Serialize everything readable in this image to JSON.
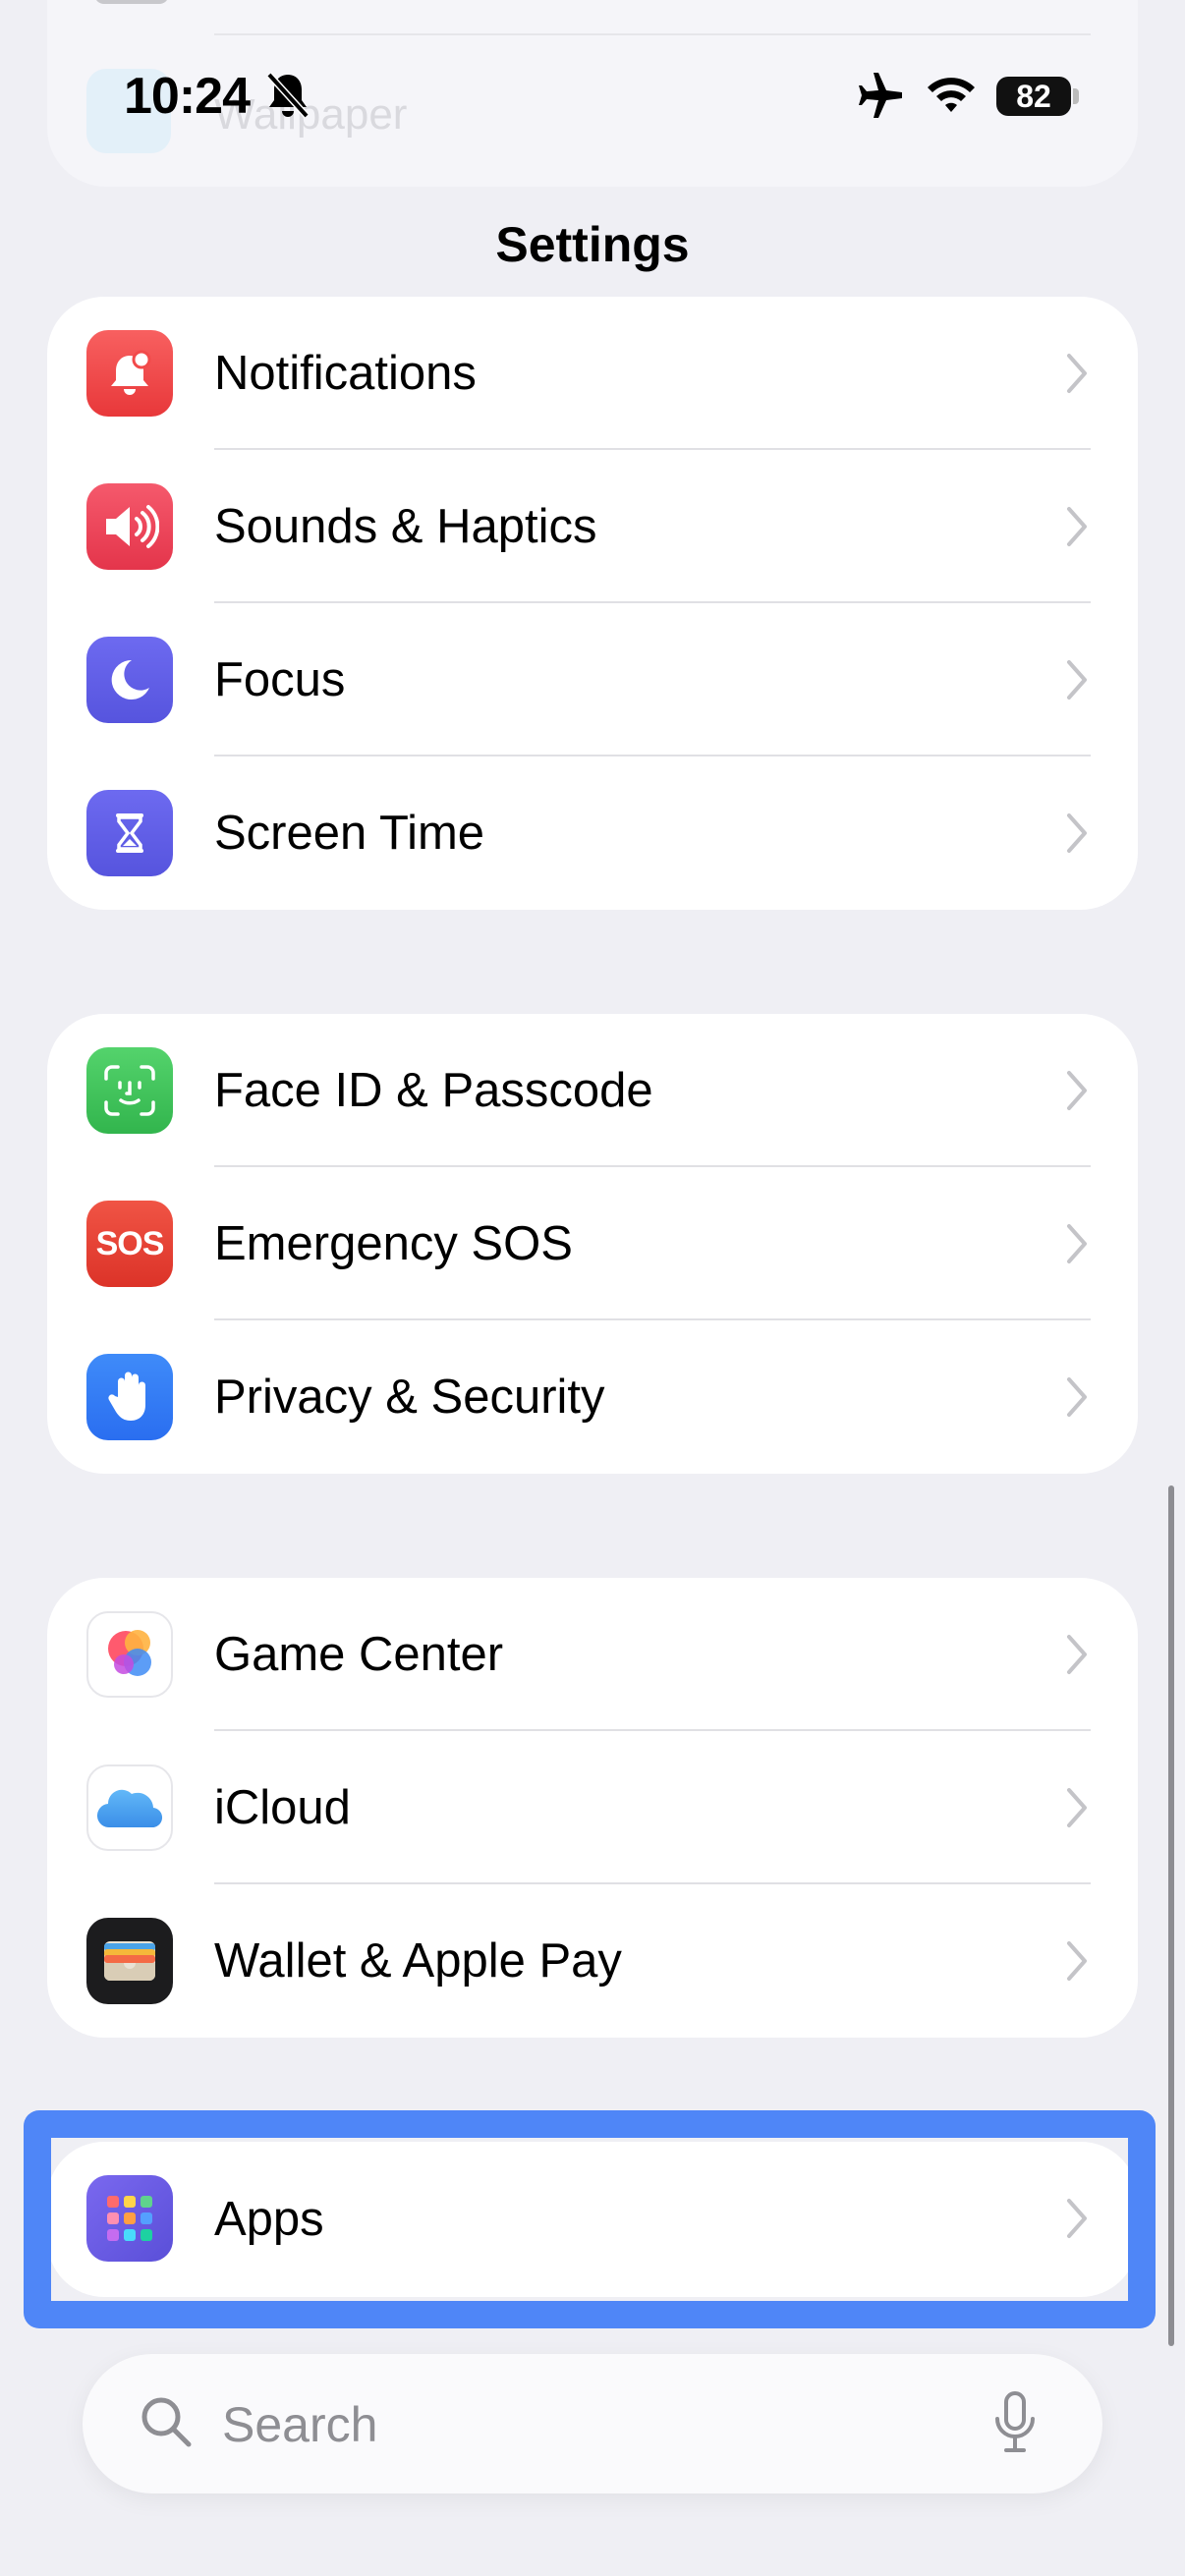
{
  "status_bar": {
    "time": "10:24",
    "battery": "82",
    "icons": [
      "bell-slash-icon",
      "airplane-icon",
      "wifi-icon",
      "battery-icon"
    ]
  },
  "header": {
    "title": "Settings",
    "behind_text": "Wallpaper"
  },
  "groups": [
    {
      "items": [
        {
          "label": "Notifications",
          "icon": "bell-badge-icon",
          "color": "#f24a4a"
        },
        {
          "label": "Sounds & Haptics",
          "icon": "speaker-icon",
          "color": "#ee4057"
        },
        {
          "label": "Focus",
          "icon": "moon-icon",
          "color": "#5e5ce6"
        },
        {
          "label": "Screen Time",
          "icon": "hourglass-icon",
          "color": "#5e5ce6"
        }
      ]
    },
    {
      "items": [
        {
          "label": "Face ID & Passcode",
          "icon": "face-id-icon",
          "color": "#34c759"
        },
        {
          "label": "Emergency SOS",
          "icon": "sos-icon",
          "icon_text": "SOS",
          "color": "#e84035"
        },
        {
          "label": "Privacy & Security",
          "icon": "hand-icon",
          "color": "#3478f6"
        }
      ]
    },
    {
      "items": [
        {
          "label": "Game Center",
          "icon": "game-center-icon",
          "color": "#ffffff"
        },
        {
          "label": "iCloud",
          "icon": "icloud-icon",
          "color": "#ffffff"
        },
        {
          "label": "Wallet & Apple Pay",
          "icon": "wallet-icon",
          "color": "#1c1c1e"
        }
      ]
    },
    {
      "items": [
        {
          "label": "Apps",
          "icon": "apps-grid-icon",
          "color": "#6b5ce7"
        }
      ]
    }
  ],
  "search": {
    "placeholder": "Search",
    "value": ""
  },
  "colors": {
    "highlight": "#4f86f7",
    "background": "#efeff4"
  }
}
